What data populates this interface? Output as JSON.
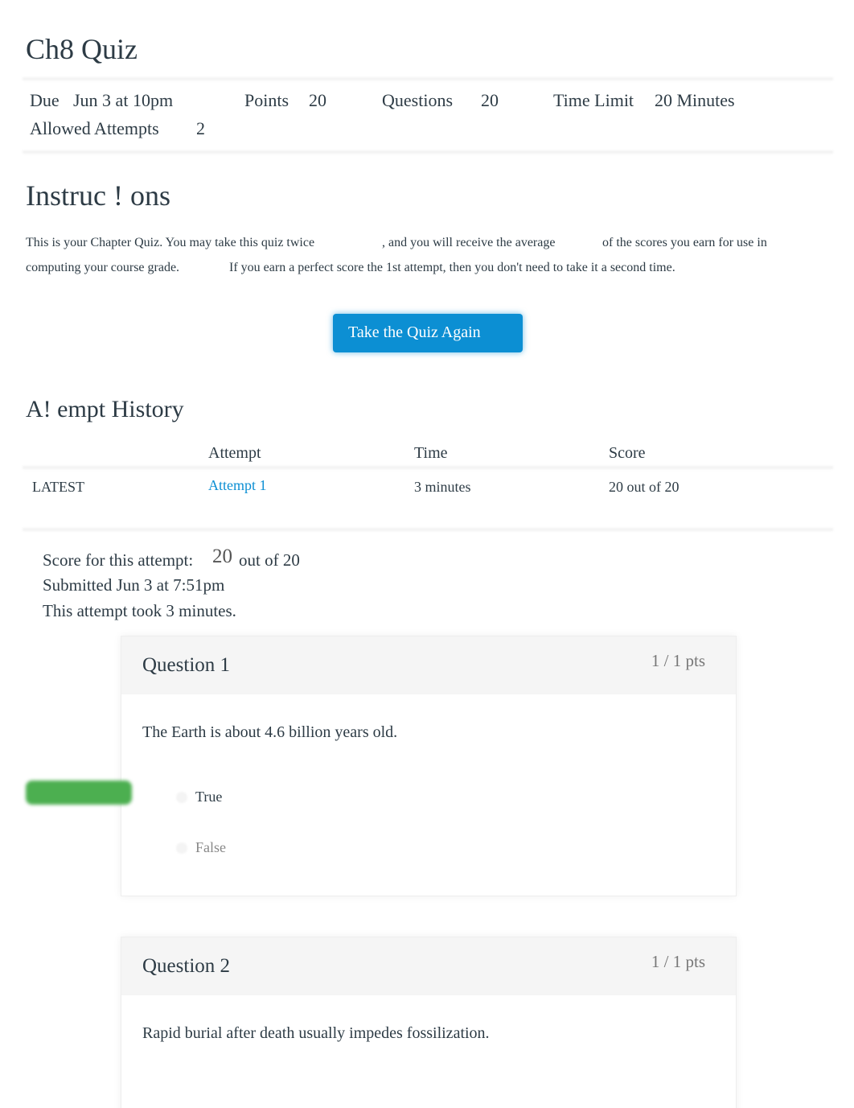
{
  "quiz": {
    "title": "Ch8 Quiz",
    "due_label": "Due",
    "due_value": "Jun 3 at 10pm",
    "points_label": "Points",
    "points_value": "20",
    "questions_label": "Questions",
    "questions_value": "20",
    "time_limit_label": "Time Limit",
    "time_limit_value": "20 Minutes",
    "attempts_label": "Allowed Attempts",
    "attempts_value": "2"
  },
  "instructions": {
    "heading": "Instruc ! ons",
    "line1a": "This is your Chapter Quiz. You may take this quiz twice",
    "line1b": ", and you will receive the average",
    "line1c": "of the scores you earn for use in",
    "line2a": "computing your course grade.",
    "line2b": "If you earn a perfect score the 1st attempt, then you don't need to take it a second time."
  },
  "take_again_label": "Take the Quiz Again",
  "history": {
    "heading": "A! empt History",
    "columns": [
      "Attempt",
      "Time",
      "Score"
    ],
    "rows": [
      {
        "tag": "LATEST",
        "attempt": "Attempt 1",
        "time": "3 minutes",
        "score": "20 out of 20"
      }
    ]
  },
  "result": {
    "score_label": "Score for this attempt:",
    "score_value": "20",
    "score_total": "out of 20",
    "submitted": "Submitted Jun 3 at 7:51pm",
    "duration": "This attempt took 3 minutes."
  },
  "questions": [
    {
      "title": "Question 1",
      "pts": "1 / 1 pts",
      "text": "The Earth is about 4.6 billion years old.",
      "answers": [
        "True",
        "False"
      ],
      "selected": "True",
      "correct": "True"
    },
    {
      "title": "Question 2",
      "pts": "1 / 1 pts",
      "text": "Rapid burial after death usually impedes fossilization."
    }
  ],
  "colors": {
    "accent": "#0c8fd3",
    "correct": "#4caf50"
  }
}
